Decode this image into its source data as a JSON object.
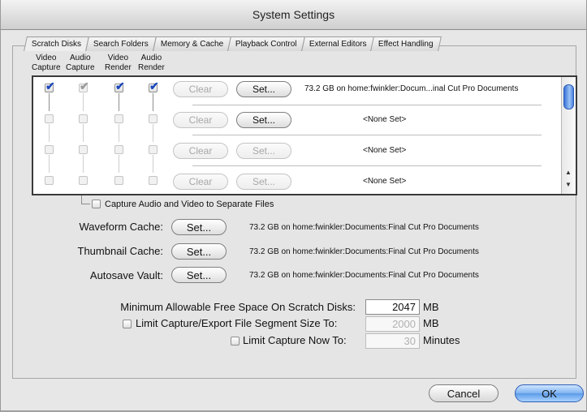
{
  "window": {
    "title": "System Settings"
  },
  "tabs": [
    "Scratch Disks",
    "Search Folders",
    "Memory & Cache",
    "Playback Control",
    "External Editors",
    "Effect Handling"
  ],
  "columns": [
    {
      "line1": "Video",
      "line2": "Capture"
    },
    {
      "line1": "Audio",
      "line2": "Capture"
    },
    {
      "line1": "Video",
      "line2": "Render"
    },
    {
      "line1": "Audio",
      "line2": "Render"
    }
  ],
  "rows": [
    {
      "checks": [
        true,
        true,
        true,
        true
      ],
      "clear_label": "Clear",
      "set_label": "Set...",
      "path": "73.2 GB on  home:fwinkler:Docum...inal Cut Pro Documents"
    },
    {
      "checks": [
        false,
        false,
        false,
        false
      ],
      "clear_label": "Clear",
      "set_label": "Set...",
      "path": "<None Set>"
    },
    {
      "checks": [
        false,
        false,
        false,
        false
      ],
      "clear_label": "Clear",
      "set_label": "Set...",
      "path": "<None Set>"
    },
    {
      "checks": [
        false,
        false,
        false,
        false
      ],
      "clear_label": "Clear",
      "set_label": "Set...",
      "path": "<None Set>"
    }
  ],
  "separate_files_label": "Capture Audio and Video to Separate Files",
  "caches": [
    {
      "label": "Waveform Cache:",
      "set_label": "Set...",
      "path": "73.2 GB on  home:fwinkler:Documents:Final Cut Pro Documents"
    },
    {
      "label": "Thumbnail Cache:",
      "set_label": "Set...",
      "path": "73.2 GB on  home:fwinkler:Documents:Final Cut Pro Documents"
    },
    {
      "label": "Autosave Vault:",
      "set_label": "Set...",
      "path": "73.2 GB on  home:fwinkler:Documents:Final Cut Pro Documents"
    }
  ],
  "min_free": {
    "label": "Minimum Allowable Free Space On Scratch Disks:",
    "value": "2047",
    "unit": "MB"
  },
  "limit_segment": {
    "label": "Limit Capture/Export File Segment Size To:",
    "value": "2000",
    "unit": "MB"
  },
  "limit_capture": {
    "label": "Limit Capture Now To:",
    "value": "30",
    "unit": "Minutes"
  },
  "buttons": {
    "cancel": "Cancel",
    "ok": "OK"
  }
}
